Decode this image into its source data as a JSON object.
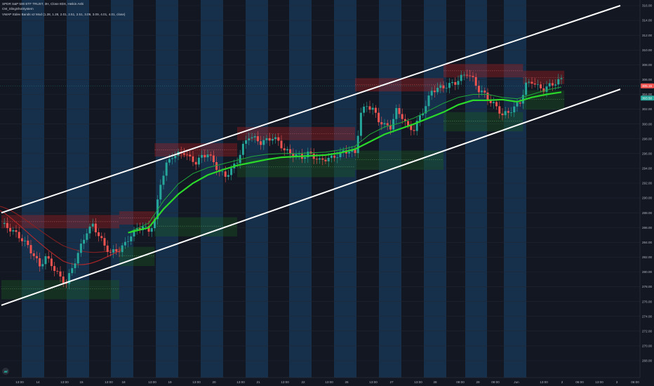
{
  "colors": {
    "background": "#131722",
    "session_band": "#16304b",
    "grid": "#222733",
    "channel_line": "#ffffff",
    "candle_up": "#26a69a",
    "candle_down": "#ef5350",
    "vwap_main": "#2bd92b",
    "vwap_inner": "#21a83a",
    "band_upper": "#b71c1c",
    "band_lower": "#1b5e20",
    "price_badge": "#ef5350",
    "price_badge_2": "#26a69a",
    "axis_text": "#b2b5be"
  },
  "legend": {
    "symbol_line": "SPDR S&P 500 ETF TRUST, 3H, Close 8DX, Heikin Ashi",
    "indicator_1": "CM_SlingShotSystem",
    "indicator_2": "VWAP Stdev Bands v2 Mod (1.28, 1.28, 2.01, 2.51, 2.51, 3.09, 3.09, 4.01, 4.01, close)"
  },
  "price_axis": {
    "ticks": [
      "316.00",
      "314.00",
      "312.00",
      "310.00",
      "308.00",
      "306.00",
      "304.00",
      "302.00",
      "300.00",
      "298.00",
      "296.00",
      "294.00",
      "292.00",
      "290.00",
      "288.00",
      "286.00",
      "284.00",
      "282.00",
      "280.00",
      "278.00",
      "276.00",
      "274.00",
      "272.00",
      "270.00",
      "268.00"
    ],
    "last_price_label": "305.15",
    "vwap_label": "303.50"
  },
  "time_axis": {
    "ticks": [
      "13:00",
      "14",
      "13:00",
      "15",
      "13:00",
      "18",
      "13:00",
      "19",
      "13:00",
      "20",
      "13:00",
      "21",
      "13:00",
      "22",
      "13:00",
      "26",
      "13:00",
      "27",
      "13:00",
      "28",
      "09:00",
      "29",
      "09:00",
      "Jun",
      "13:00",
      "2",
      "06:00",
      "13:00",
      "3",
      "06:00"
    ]
  },
  "chart_data": {
    "type": "candlestick",
    "symbol": "SPDR S&P 500 ETF TRUST",
    "interval": "3H",
    "style": "Heikin Ashi",
    "ylim": [
      267,
      317
    ],
    "y_ticks": [
      268,
      270,
      272,
      274,
      276,
      278,
      280,
      282,
      284,
      286,
      288,
      290,
      292,
      294,
      296,
      298,
      300,
      302,
      304,
      306,
      308,
      310,
      312,
      314,
      316
    ],
    "grid": true,
    "legend_position": "top-left",
    "price_path": [
      [
        0,
        286.5
      ],
      [
        3,
        285.8
      ],
      [
        6,
        284.8
      ],
      [
        9,
        283.5
      ],
      [
        11,
        282.2
      ],
      [
        13,
        280.8
      ],
      [
        15,
        282.0
      ],
      [
        17,
        281.0
      ],
      [
        20,
        279.2
      ],
      [
        22,
        278.5
      ],
      [
        24,
        280.5
      ],
      [
        26,
        282.5
      ],
      [
        29,
        285.5
      ],
      [
        31,
        286.3
      ],
      [
        33,
        285.0
      ],
      [
        35,
        283.5
      ],
      [
        37,
        282.6
      ],
      [
        40,
        283.0
      ],
      [
        42,
        283.8
      ],
      [
        44,
        285.0
      ],
      [
        46,
        285.8
      ],
      [
        48,
        286.2
      ],
      [
        50,
        285.5
      ],
      [
        52,
        287.0
      ],
      [
        54,
        292.0
      ],
      [
        56,
        294.5
      ],
      [
        58,
        295.7
      ],
      [
        60,
        295.9
      ],
      [
        62,
        296.2
      ],
      [
        64,
        295.3
      ],
      [
        66,
        294.8
      ],
      [
        68,
        295.6
      ],
      [
        70,
        296.0
      ],
      [
        72,
        294.8
      ],
      [
        74,
        293.5
      ],
      [
        76,
        293.0
      ],
      [
        78,
        293.8
      ],
      [
        80,
        295.0
      ],
      [
        82,
        297.0
      ],
      [
        84,
        298.4
      ],
      [
        86,
        298.0
      ],
      [
        88,
        297.5
      ],
      [
        90,
        297.8
      ],
      [
        92,
        298.2
      ],
      [
        94,
        297.6
      ],
      [
        96,
        296.5
      ],
      [
        98,
        296.0
      ],
      [
        100,
        295.8
      ],
      [
        102,
        295.5
      ],
      [
        104,
        296.0
      ],
      [
        106,
        295.6
      ],
      [
        108,
        295.0
      ],
      [
        110,
        295.3
      ],
      [
        112,
        295.4
      ],
      [
        114,
        295.8
      ],
      [
        116,
        296.2
      ],
      [
        118,
        296.4
      ],
      [
        120,
        296.0
      ],
      [
        122,
        301.5
      ],
      [
        124,
        302.5
      ],
      [
        126,
        302.0
      ],
      [
        128,
        300.5
      ],
      [
        130,
        299.8
      ],
      [
        132,
        299.6
      ],
      [
        134,
        301.8
      ],
      [
        136,
        301.0
      ],
      [
        138,
        299.5
      ],
      [
        140,
        299.3
      ],
      [
        142,
        301.0
      ],
      [
        144,
        302.5
      ],
      [
        146,
        304.5
      ],
      [
        148,
        304.8
      ],
      [
        150,
        305.0
      ],
      [
        152,
        305.3
      ],
      [
        154,
        305.6
      ],
      [
        156,
        306.3
      ],
      [
        158,
        306.9
      ],
      [
        160,
        306.0
      ],
      [
        162,
        304.6
      ],
      [
        164,
        304.0
      ],
      [
        166,
        303.0
      ],
      [
        168,
        302.3
      ],
      [
        170,
        301.2
      ],
      [
        172,
        301.6
      ],
      [
        174,
        302.2
      ],
      [
        176,
        303.0
      ],
      [
        178,
        305.3
      ],
      [
        180,
        305.8
      ],
      [
        182,
        305.0
      ],
      [
        184,
        304.7
      ],
      [
        186,
        305.2
      ],
      [
        188,
        305.6
      ],
      [
        190,
        306.0
      ]
    ],
    "vwap_main": [
      [
        43,
        285.3
      ],
      [
        50,
        286.0
      ],
      [
        55,
        288.5
      ],
      [
        60,
        290.5
      ],
      [
        65,
        292.0
      ],
      [
        70,
        293.1
      ],
      [
        75,
        293.8
      ],
      [
        80,
        294.4
      ],
      [
        85,
        294.8
      ],
      [
        90,
        295.2
      ],
      [
        95,
        295.5
      ],
      [
        100,
        295.6
      ],
      [
        105,
        295.7
      ],
      [
        110,
        295.8
      ],
      [
        115,
        296.1
      ],
      [
        120,
        296.6
      ],
      [
        125,
        297.6
      ],
      [
        130,
        298.6
      ],
      [
        135,
        299.3
      ],
      [
        140,
        300.0
      ],
      [
        145,
        300.8
      ],
      [
        150,
        301.6
      ],
      [
        155,
        302.6
      ],
      [
        160,
        303.2
      ],
      [
        165,
        303.2
      ],
      [
        170,
        303.3
      ],
      [
        175,
        303.0
      ],
      [
        180,
        303.6
      ],
      [
        185,
        304.0
      ],
      [
        190,
        304.3
      ]
    ],
    "vwap_inner": [
      [
        43,
        285.3
      ],
      [
        50,
        286.6
      ],
      [
        55,
        289.6
      ],
      [
        60,
        291.9
      ],
      [
        65,
        293.3
      ],
      [
        70,
        294.1
      ],
      [
        75,
        294.6
      ],
      [
        80,
        295.1
      ],
      [
        85,
        295.6
      ],
      [
        90,
        295.9
      ],
      [
        95,
        296.0
      ],
      [
        100,
        296.0
      ],
      [
        105,
        296.1
      ],
      [
        110,
        296.2
      ],
      [
        115,
        296.5
      ],
      [
        120,
        297.0
      ],
      [
        125,
        298.6
      ],
      [
        130,
        299.6
      ],
      [
        135,
        300.1
      ],
      [
        140,
        300.8
      ],
      [
        145,
        301.8
      ],
      [
        150,
        302.8
      ],
      [
        155,
        303.6
      ],
      [
        160,
        304.0
      ],
      [
        165,
        304.0
      ],
      [
        170,
        303.6
      ],
      [
        175,
        303.4
      ],
      [
        180,
        304.0
      ],
      [
        185,
        304.6
      ],
      [
        190,
        305.0
      ]
    ],
    "channel_upper": [
      [
        0,
        288.0
      ],
      [
        210,
        316.0
      ]
    ],
    "channel_lower": [
      [
        0,
        275.5
      ],
      [
        210,
        304.7
      ]
    ],
    "last_price": 305.15,
    "vwap_last": 303.5
  }
}
